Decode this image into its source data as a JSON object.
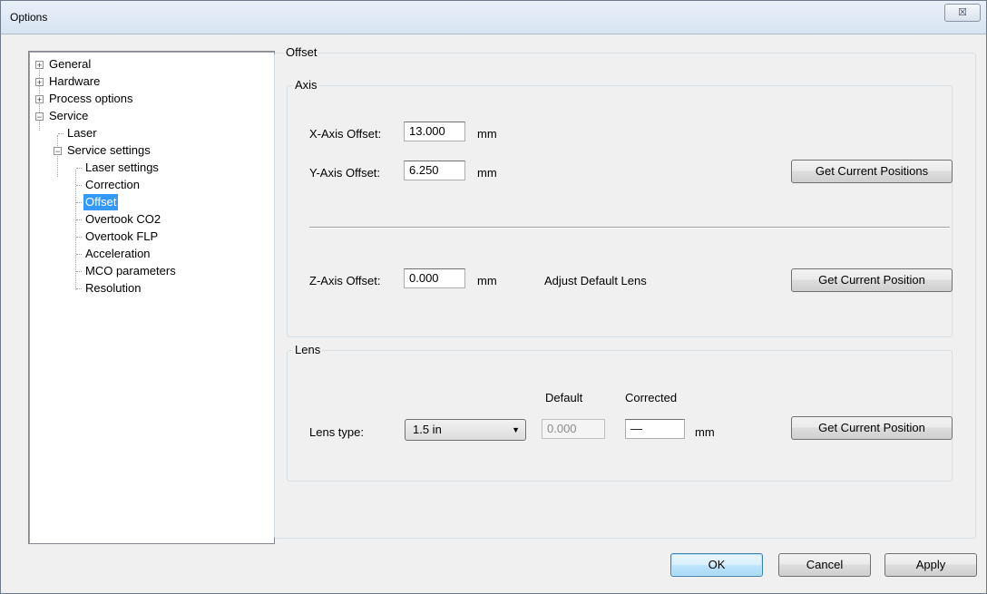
{
  "window": {
    "title": "Options",
    "close_glyph": "☒"
  },
  "tree": {
    "items": [
      {
        "label": "General",
        "expander": "+"
      },
      {
        "label": "Hardware",
        "expander": "+"
      },
      {
        "label": "Process options",
        "expander": "+"
      },
      {
        "label": "Service",
        "expander": "−"
      },
      {
        "label": "Laser"
      },
      {
        "label": "Service settings",
        "expander": "−"
      },
      {
        "label": "Laser settings"
      },
      {
        "label": "Correction"
      },
      {
        "label": "Offset",
        "selected": true
      },
      {
        "label": "Overtook CO2"
      },
      {
        "label": "Overtook FLP"
      },
      {
        "label": "Acceleration"
      },
      {
        "label": "MCO parameters"
      },
      {
        "label": "Resolution"
      }
    ]
  },
  "offset_group": {
    "title": "Offset"
  },
  "axis_group": {
    "title": "Axis",
    "x_label": "X-Axis Offset:",
    "x_value": "13.000",
    "x_unit": "mm",
    "y_label": "Y-Axis Offset:",
    "y_value": "6.250",
    "y_unit": "mm",
    "get_positions_button": "Get Current Positions",
    "z_label": "Z-Axis Offset:",
    "z_value": "0.000",
    "z_unit": "mm",
    "adjust_label": "Adjust Default Lens",
    "get_position_button": "Get Current Position"
  },
  "lens_group": {
    "title": "Lens",
    "default_header": "Default",
    "corrected_header": "Corrected",
    "lens_type_label": "Lens type:",
    "lens_type_value": "1.5 in",
    "default_value": "0.000",
    "corrected_value": "—",
    "unit": "mm",
    "get_position_button": "Get Current Position"
  },
  "footer": {
    "ok": "OK",
    "cancel": "Cancel",
    "apply": "Apply"
  }
}
